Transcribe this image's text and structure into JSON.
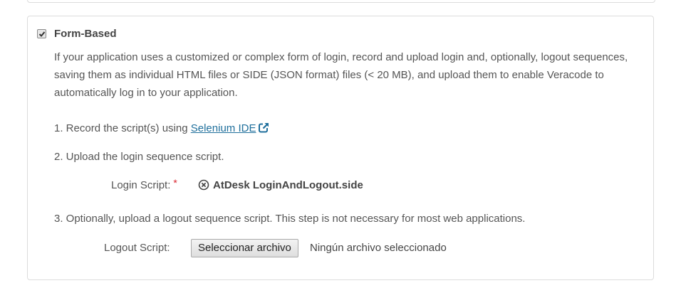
{
  "section": {
    "checkbox_checked": true,
    "title": "Form-Based",
    "description": "If your application uses a customized or complex form of login, record and upload login and, optionally, logout sequences, saving them as individual HTML files or SIDE (JSON format) files (< 20 MB), and upload them to enable Veracode to automatically log in to your application."
  },
  "steps": {
    "step1_prefix": "1. Record the script(s) using ",
    "step1_link": "Selenium IDE",
    "step2": "2. Upload the login sequence script.",
    "step3": "3. Optionally, upload a logout sequence script. This step is not necessary for most web applications."
  },
  "login_script": {
    "label": "Login Script:",
    "required_marker": "*",
    "file_name": "AtDesk LoginAndLogout.side",
    "remove_icon": "circle-x-icon"
  },
  "logout_script": {
    "label": "Logout Script:",
    "button_label": "Seleccionar archivo",
    "status": "Ningún archivo seleccionado"
  },
  "colors": {
    "link": "#1f6f9c",
    "required": "#d9232d",
    "border": "#dcdcdc"
  },
  "icons": {
    "external_link": "external-link-icon",
    "checkbox": "checkbox-checked-icon"
  }
}
